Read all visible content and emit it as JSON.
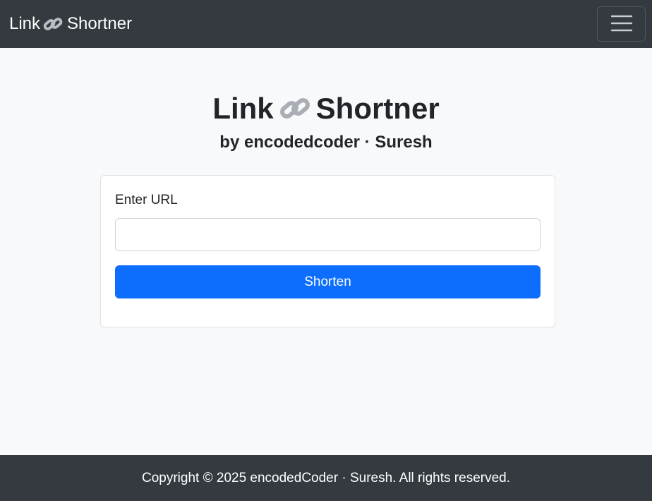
{
  "navbar": {
    "brand_left": "Link",
    "brand_right": "Shortner",
    "brand_icon": "link-chain-icon",
    "toggler_icon": "hamburger-menu-icon"
  },
  "hero": {
    "title_left": "Link",
    "title_right": "Shortner",
    "title_icon": "link-chain-icon",
    "subtitle": "by encodedcoder · Suresh"
  },
  "form": {
    "label": "Enter URL",
    "input_value": "",
    "input_placeholder": "",
    "submit_label": "Shorten"
  },
  "footer": {
    "copyright": "Copyright © 2025 encodedCoder · Suresh. All rights reserved."
  },
  "colors": {
    "navbar_bg": "#343a40",
    "page_bg": "#f8f9fa",
    "primary": "#0d6efd",
    "text": "#212529"
  }
}
